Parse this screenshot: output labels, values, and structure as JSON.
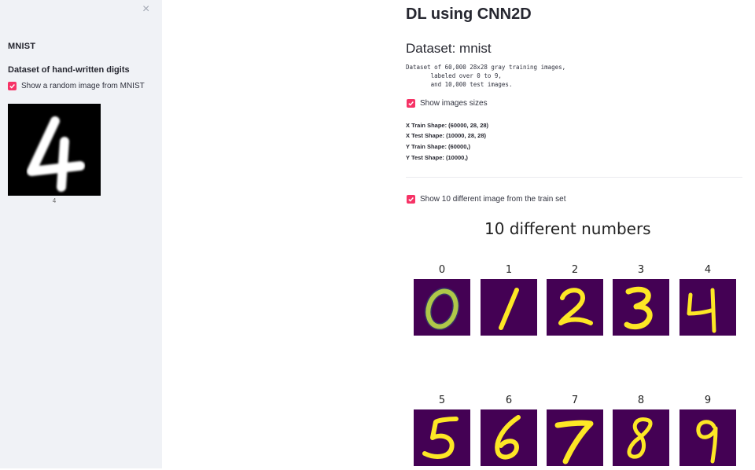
{
  "sidebar": {
    "title": "MNIST",
    "subtitle": "Dataset of hand-written digits",
    "checkbox_random": "Show a random image from MNIST",
    "random_image_caption": "4",
    "random_image_digit": "4"
  },
  "main": {
    "title": "DL using CNN2D",
    "dataset_header": "Dataset: mnist",
    "dataset_description": "Dataset of 60,000 28x28 gray training images,\n       labeled over 0 to 9,\n       and 10,000 test images.",
    "checkbox_sizes": "Show images sizes",
    "shapes": [
      "X Train Shape: (60000, 28, 28)",
      "X Test Shape: (10000, 28, 28)",
      "Y Train Shape: (60000,)",
      "Y Test Shape: (10000,)"
    ],
    "checkbox_ten": "Show 10 different image from the train set",
    "figure_title": "10 different numbers",
    "digits": [
      "0",
      "1",
      "2",
      "3",
      "4",
      "5",
      "6",
      "7",
      "8",
      "9"
    ]
  },
  "colors": {
    "accent": "#f63366",
    "sidebar_bg": "#f0f2f6",
    "tile_bg": "#440154",
    "digit_yellow": "#fde725"
  }
}
